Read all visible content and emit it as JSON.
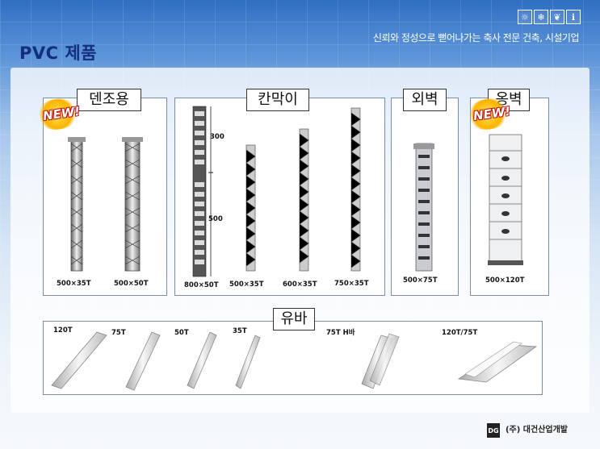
{
  "header": {
    "title": "PVC 제품",
    "slogan": "신뢰와 정성으로 뻗어나가는 축사 전문 건축, 시설기업"
  },
  "sections": {
    "dencho": {
      "label": "덴조용",
      "badge": "NEW!",
      "items": [
        "500×35T",
        "500×50T"
      ]
    },
    "kanmagi": {
      "label": "칸막이",
      "items": [
        "800×50T",
        "500×35T",
        "600×35T",
        "750×35T"
      ],
      "dim_top": "300",
      "dim_bottom": "500"
    },
    "oebyeok": {
      "label": "외벽",
      "items": [
        "500×75T"
      ]
    },
    "ongbyeok": {
      "label": "옹벽",
      "badge": "NEW!",
      "items": [
        "500×120T"
      ]
    },
    "yuba": {
      "label": "유바",
      "items": [
        "120T",
        "75T",
        "50T",
        "35T",
        "75T H바",
        "120T/75T"
      ]
    }
  },
  "footer": {
    "company": "(주) 대건산업개발",
    "logo": "DG"
  },
  "icons": [
    "sun-icon",
    "snowflake-icon",
    "leaf-icon",
    "info-icon"
  ]
}
